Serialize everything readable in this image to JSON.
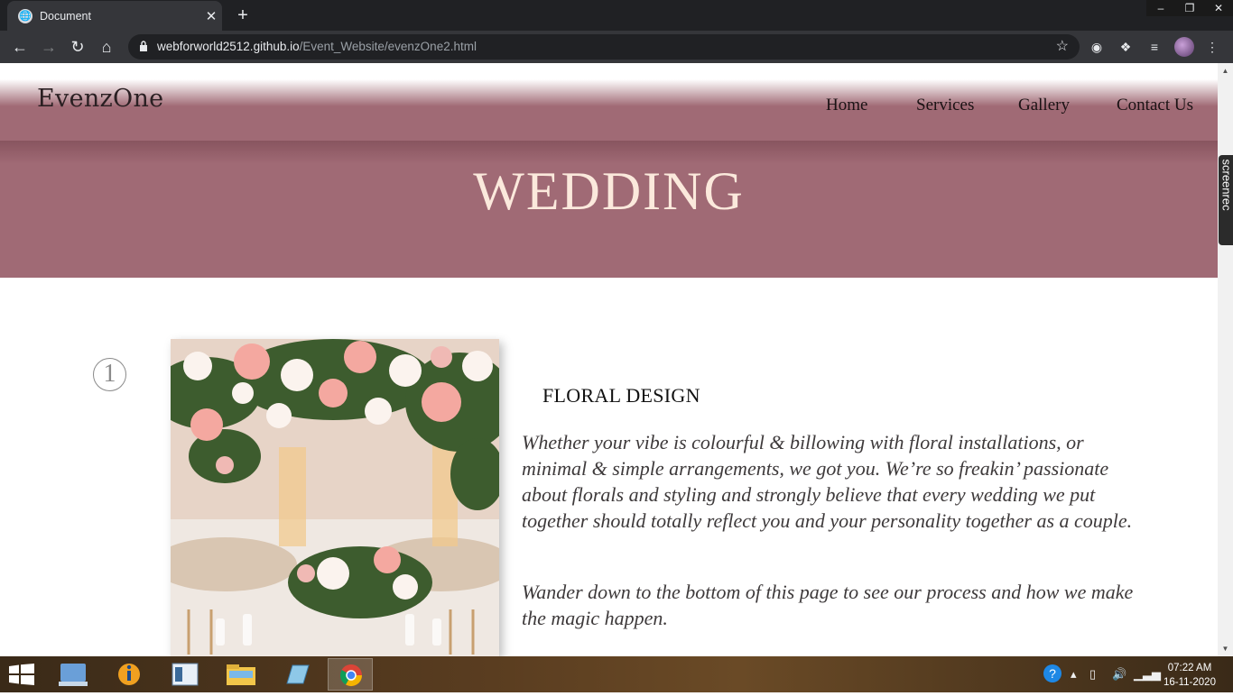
{
  "browser": {
    "tab_title": "Document",
    "url_host": "webforworld2512.github.io",
    "url_path": "/Event_Website/evenzOne2.html"
  },
  "site": {
    "logo": "EvenzOne",
    "nav": [
      {
        "label": "Home"
      },
      {
        "label": "Services"
      },
      {
        "label": "Gallery"
      },
      {
        "label": "Contact Us"
      }
    ],
    "hero_title": "WEDDING"
  },
  "section": {
    "number": "1",
    "title": "FLORAL DESIGN",
    "paragraphs": [
      "Whether your vibe is colourful & billowing with floral installations, or minimal & simple arrangements, we got you. We’re so freakin’ passionate about florals and styling and strongly believe that every wedding we put together should totally reflect you and your personality together as a couple.",
      "Wander down to the bottom of this page to see our process and how we make the magic happen."
    ]
  },
  "overlay": {
    "screenrec_label": "screenrec"
  },
  "taskbar": {
    "time": "07:22 AM",
    "date": "16-11-2020"
  },
  "colors": {
    "header_mauve": "#a06a75",
    "hero_text": "#fbe9dc",
    "browser_dark": "#202124",
    "browser_toolbar": "#35363a"
  }
}
